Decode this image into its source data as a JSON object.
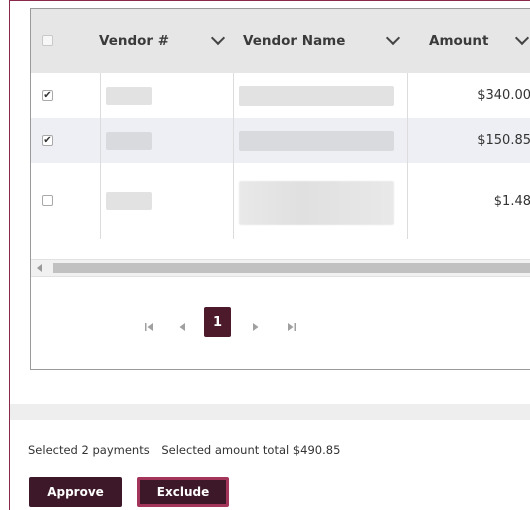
{
  "grid": {
    "columns": [
      {
        "key": "select",
        "label": ""
      },
      {
        "key": "vendor_num",
        "label": "Vendor #"
      },
      {
        "key": "vendor_name",
        "label": "Vendor Name"
      },
      {
        "key": "amount",
        "label": "Amount"
      }
    ],
    "rows": [
      {
        "checked": true,
        "vendor_num": "",
        "vendor_name": "",
        "amount": "$340.00"
      },
      {
        "checked": true,
        "vendor_num": "",
        "vendor_name": "",
        "amount": "$150.85"
      },
      {
        "checked": false,
        "vendor_num": "",
        "vendor_name": "",
        "amount": "$1.48"
      }
    ],
    "pager": {
      "first_icon": "first-page-icon",
      "prev_icon": "previous-page-icon",
      "current_page": "1",
      "next_icon": "next-page-icon",
      "last_icon": "last-page-icon"
    }
  },
  "summary": {
    "selected_count_text": "Selected 2 payments",
    "selected_total_text": "Selected amount total $490.85"
  },
  "actions": {
    "approve_label": "Approve",
    "exclude_label": "Exclude"
  },
  "colors": {
    "accent": "#4d1a2c",
    "button": "#3d1828",
    "exclude_border": "#a3345a"
  }
}
